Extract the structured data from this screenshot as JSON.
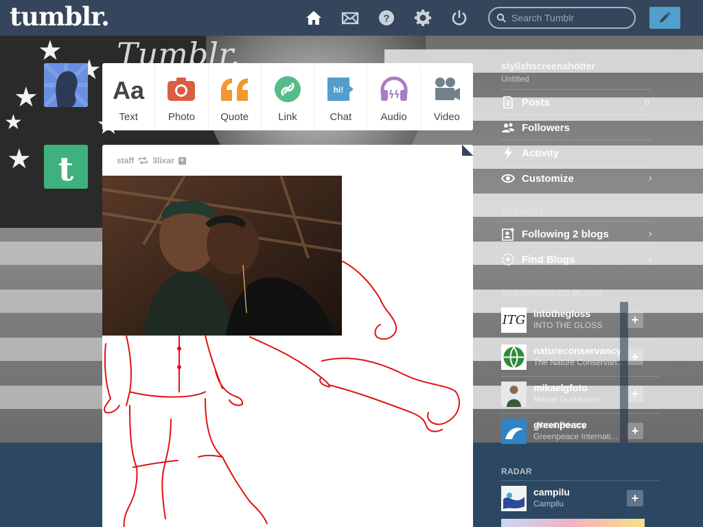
{
  "topbar": {
    "logo": "tumblr.",
    "search_placeholder": "Search Tumblr",
    "nav": [
      "home-icon",
      "mail-icon",
      "help-icon",
      "gear-icon",
      "power-icon"
    ],
    "compose_icon": "pencil-icon"
  },
  "background": {
    "script_logo": "Tumblr."
  },
  "post_types": [
    {
      "label": "Text",
      "icon": "text-icon",
      "color": "#444444"
    },
    {
      "label": "Photo",
      "icon": "camera-icon",
      "color": "#d95e40"
    },
    {
      "label": "Quote",
      "icon": "quote-icon",
      "color": "#f2992e"
    },
    {
      "label": "Link",
      "icon": "link-icon",
      "color": "#56bc8a"
    },
    {
      "label": "Chat",
      "icon": "chat-icon",
      "color": "#529ecc"
    },
    {
      "label": "Audio",
      "icon": "headphones-icon",
      "color": "#a77dc2"
    },
    {
      "label": "Video",
      "icon": "video-camera-icon",
      "color": "#748089"
    }
  ],
  "post": {
    "author": "staff",
    "reblogged_from": "3lixar"
  },
  "sidebar": {
    "username": "stylishscreenshotter",
    "blog_title": "Untitled",
    "menu": [
      {
        "label": "Posts",
        "count": "0",
        "icon": "document-icon"
      },
      {
        "label": "Followers",
        "count": "",
        "icon": "people-icon"
      },
      {
        "label": "Activity",
        "count": "",
        "icon": "lightning-icon"
      },
      {
        "label": "Customize",
        "count": "",
        "icon": "eye-icon"
      }
    ],
    "account_header": "ACCOUNT",
    "account": [
      {
        "label": "Following 2 blogs",
        "icon": "add-user-icon"
      },
      {
        "label": "Find Blogs",
        "icon": "compass-icon"
      }
    ],
    "recommended_header": "RECOMMENDED BLOGS",
    "recommended": [
      {
        "name": "intothegloss",
        "subtitle": "INTO THE GLOSS"
      },
      {
        "name": "natureconservancy",
        "subtitle": "The Nature Conservan..."
      },
      {
        "name": "mikaelgfoto",
        "subtitle": "Mikael Gustavson"
      },
      {
        "name": "greenpeace",
        "subtitle": "Greenpeace Internati..."
      }
    ],
    "popover": "About  Privacy",
    "radar_header": "RADAR",
    "radar": [
      {
        "name": "campilu",
        "subtitle": "Campilu"
      }
    ]
  }
}
